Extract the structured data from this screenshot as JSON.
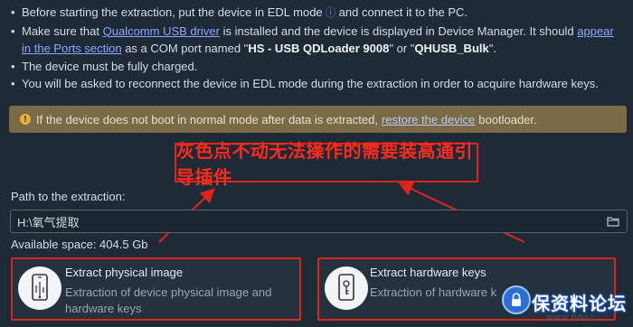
{
  "instructions": {
    "b1_pre": "Before starting the extraction, put the device in EDL mode",
    "b1_post": "and connect it to the PC.",
    "b2_pre": "Make sure that",
    "b2_link1": "Qualcomm USB driver",
    "b2_mid": "is installed and the device is displayed in Device Manager. It should",
    "b2_link2": "appear in the Ports section",
    "b2_mid2": "as a COM port named \"",
    "b2_port1": "HS - USB QDLoader 9008",
    "b2_or": "\" or \"",
    "b2_port2": "QHUSB_Bulk",
    "b2_end": "\".",
    "b3": "The device must be fully charged.",
    "b4": "You will be asked to reconnect the device in EDL mode during the extraction in order to acquire hardware keys."
  },
  "warning": {
    "pre": "If the device does not boot in normal mode after data is extracted,",
    "link": "restore the device",
    "post": "bootloader."
  },
  "overlay_note": "灰色点不动无法操作的需要装高通引导插件",
  "path": {
    "label": "Path to the extraction:",
    "value": "H:\\氧气提取"
  },
  "available_space": "Available space: 404.5 Gb",
  "cards": [
    {
      "title": "Extract physical image",
      "desc": "Extraction of device physical image and hardware keys"
    },
    {
      "title": "Extract hardware keys",
      "desc": "Extraction of hardware k"
    }
  ],
  "watermark": {
    "text": "保资料论坛",
    "url": "www.baoz..."
  },
  "colors": {
    "background": "#1e2a36",
    "warning_bg": "#7a6a45",
    "highlight_red": "#e0241b",
    "link": "#8fa7ff"
  }
}
